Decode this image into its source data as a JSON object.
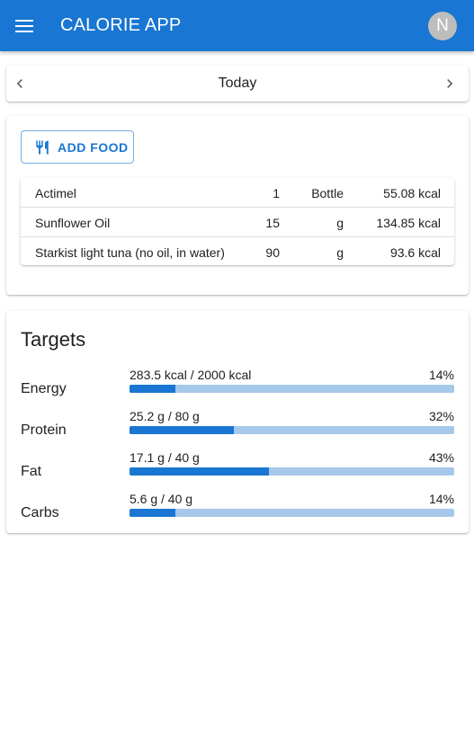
{
  "app": {
    "title": "CALORIE APP",
    "avatar_initial": "N"
  },
  "colors": {
    "primary": "#1976d2",
    "bar_track": "#a6c8ea",
    "avatar_bg": "#bdbdbd"
  },
  "date_nav": {
    "label": "Today",
    "prev_icon": "chevron-left-icon",
    "next_icon": "chevron-right-icon"
  },
  "add_food": {
    "label": "ADD FOOD",
    "icon": "restaurant-icon"
  },
  "food_log": [
    {
      "name": "Actimel",
      "quantity": "1",
      "unit": "Bottle",
      "energy": "55.08 kcal"
    },
    {
      "name": "Sunflower Oil",
      "quantity": "15",
      "unit": "g",
      "energy": "134.85 kcal"
    },
    {
      "name": "Starkist light tuna (no oil, in water)",
      "quantity": "90",
      "unit": "g",
      "energy": "93.6 kcal"
    }
  ],
  "targets": {
    "title": "Targets",
    "items": [
      {
        "label": "Energy",
        "value": "283.5 kcal / 2000 kcal",
        "percent_label": "14%",
        "progress": 0.14
      },
      {
        "label": "Protein",
        "value": "25.2 g / 80 g",
        "percent_label": "32%",
        "progress": 0.32
      },
      {
        "label": "Fat",
        "value": "17.1 g / 40 g",
        "percent_label": "43%",
        "progress": 0.43
      },
      {
        "label": "Carbs",
        "value": "5.6 g / 40 g",
        "percent_label": "14%",
        "progress": 0.14
      }
    ]
  }
}
